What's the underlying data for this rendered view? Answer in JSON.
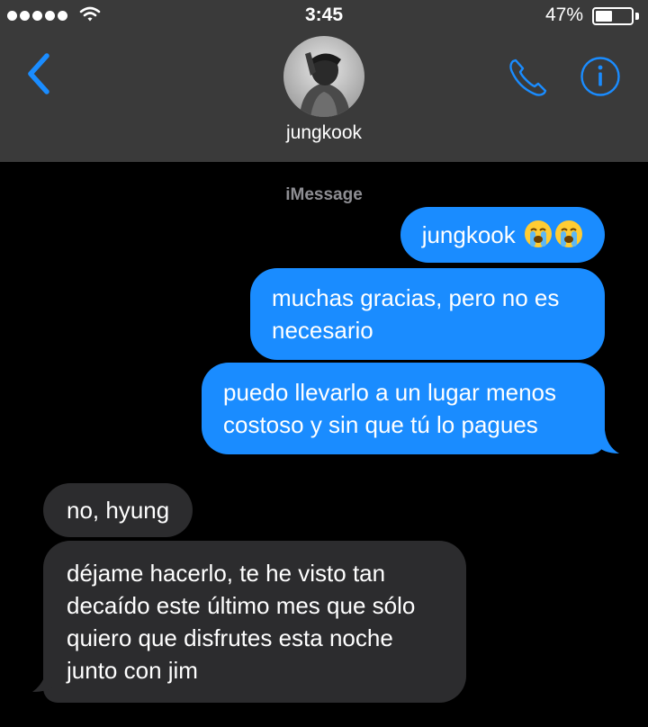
{
  "status_bar": {
    "time": "3:45",
    "battery_percent": "47%",
    "battery_level": 0.47,
    "signal_icon": "signal-dots-icon",
    "wifi_icon": "wifi-icon"
  },
  "header": {
    "contact_name": "jungkook",
    "back_icon": "chevron-left-icon",
    "call_icon": "phone-icon",
    "info_icon": "info-icon",
    "accent_color": "#1a8cff"
  },
  "conversation": {
    "service_label": "iMessage",
    "messages": [
      {
        "direction": "outgoing",
        "text": "jungkook",
        "emoji": [
          "loudly-crying-face",
          "loudly-crying-face"
        ]
      },
      {
        "direction": "outgoing",
        "text": "muchas gracias, pero no es necesario"
      },
      {
        "direction": "outgoing",
        "text": "puedo llevarlo a un lugar menos costoso y sin que tú lo pagues"
      },
      {
        "direction": "incoming",
        "text": "no, hyung"
      },
      {
        "direction": "incoming",
        "text": "déjame hacerlo, te he visto tan decaído este último mes que sólo quiero que disfrutes esta noche junto con jim"
      }
    ],
    "outgoing_color": "#1a8cff",
    "incoming_color": "#2c2c2e"
  }
}
